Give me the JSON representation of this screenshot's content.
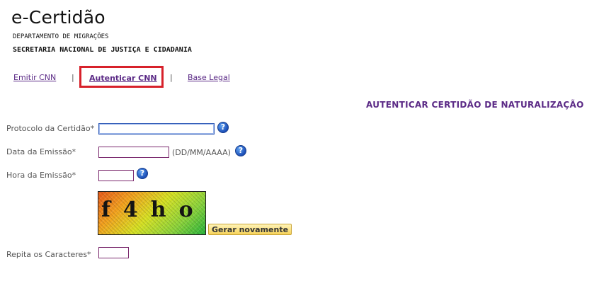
{
  "header": {
    "title": "e-Certidão",
    "department": "DEPARTAMENTO DE MIGRAÇÕES",
    "secretariat": "SECRETARIA NACIONAL DE JUSTIÇA E CIDADANIA"
  },
  "nav": {
    "items": [
      {
        "label": "Emitir CNN"
      },
      {
        "label": "Autenticar CNN",
        "active": true
      },
      {
        "label": "Base Legal"
      }
    ],
    "separator": "|"
  },
  "page": {
    "title": "AUTENTICAR CERTIDÃO DE NATURALIZAÇÃO"
  },
  "form": {
    "protocol_label": "Protocolo da Certidão*",
    "protocol_value": "",
    "date_label": "Data da Emissão*",
    "date_value": "",
    "date_hint": "(DD/MM/AAAA)",
    "time_label": "Hora da Emissão*",
    "time_value": "",
    "captcha_text": "f4ho",
    "regenerate_label": "Gerar novamente",
    "repeat_label": "Repita os Caracteres*",
    "repeat_value": ""
  },
  "colors": {
    "accent": "#5b2a86",
    "highlight": "#d7212b",
    "help_icon": "#1c4fb8"
  }
}
